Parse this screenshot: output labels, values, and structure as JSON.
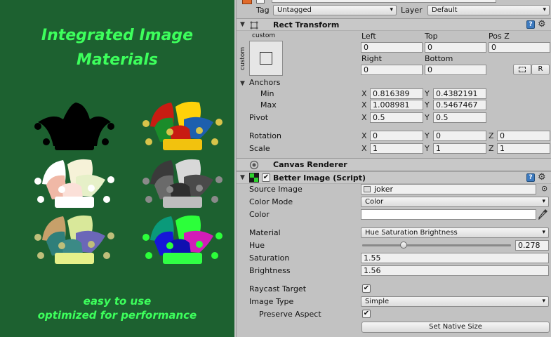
{
  "promo": {
    "title_line1": "Integrated Image",
    "title_line2": "Materials",
    "tagline_line1": "easy to use",
    "tagline_line2": "optimized for performance"
  },
  "inspector": {
    "top": {
      "tag_label": "Tag",
      "tag_value": "Untagged",
      "layer_label": "Layer",
      "layer_value": "Default"
    },
    "rect_transform": {
      "title": "Rect Transform",
      "anchor_preset_top": "custom",
      "anchor_preset_side": "custom",
      "left_label": "Left",
      "top_label": "Top",
      "posz_label": "Pos Z",
      "left_value": "0",
      "top_value": "0",
      "posz_value": "0",
      "right_label": "Right",
      "bottom_label": "Bottom",
      "right_value": "0",
      "bottom_value": "0",
      "r_button": "R",
      "anchors_label": "Anchors",
      "min_label": "Min",
      "min_x": "0.816389",
      "min_y": "0.4382191",
      "max_label": "Max",
      "max_x": "1.008981",
      "max_y": "0.5467467",
      "pivot_label": "Pivot",
      "pivot_x": "0.5",
      "pivot_y": "0.5",
      "rotation_label": "Rotation",
      "rot_x": "0",
      "rot_y": "0",
      "rot_z": "0",
      "scale_label": "Scale",
      "scale_x": "1",
      "scale_y": "1",
      "scale_z": "1",
      "axis_x": "X",
      "axis_y": "Y",
      "axis_z": "Z"
    },
    "canvas_renderer": {
      "title": "Canvas Renderer"
    },
    "better_image": {
      "title": "Better Image (Script)",
      "source_image_label": "Source Image",
      "source_image_value": "joker",
      "color_mode_label": "Color Mode",
      "color_mode_value": "Color",
      "color_label": "Color",
      "material_label": "Material",
      "material_value": "Hue Saturation Brightness",
      "hue_label": "Hue",
      "hue_value": "0.278",
      "hue_fraction": 0.278,
      "saturation_label": "Saturation",
      "saturation_value": "1.55",
      "brightness_label": "Brightness",
      "brightness_value": "1.56",
      "raycast_label": "Raycast Target",
      "image_type_label": "Image Type",
      "image_type_value": "Simple",
      "preserve_label": "Preserve Aspect",
      "native_size_button": "Set Native Size"
    },
    "help_glyph": "?",
    "gear_glyph": "⚙",
    "dropdown_arrow": "▾",
    "check_glyph": "✔",
    "fold_glyph": "▼"
  },
  "colors": {
    "promo_bg": "#1d6130",
    "promo_text": "#3dff5c",
    "inspector_bg": "#c2c2c2"
  }
}
